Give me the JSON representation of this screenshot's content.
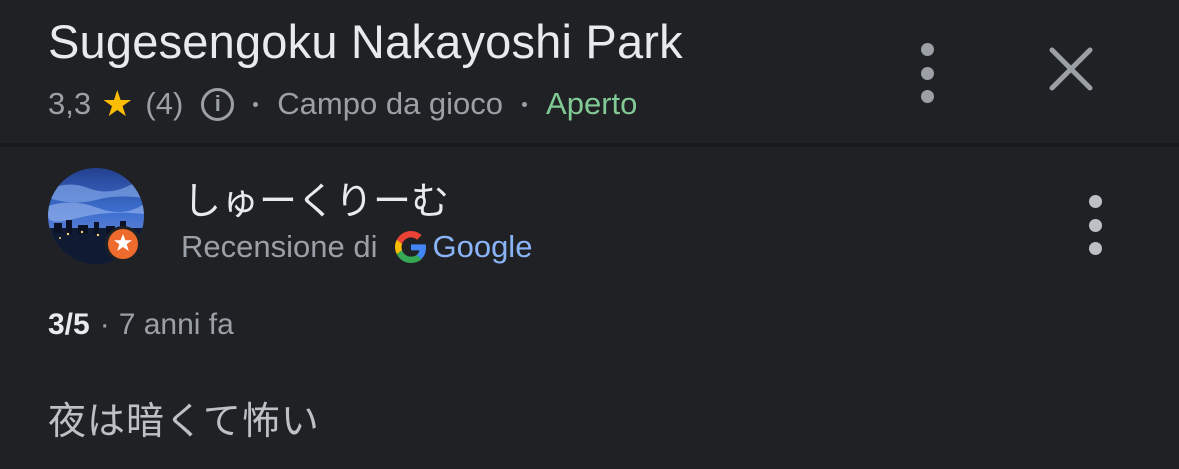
{
  "place": {
    "name": "Sugesengoku Nakayoshi Park",
    "rating": "3,3",
    "review_count": "(4)",
    "category": "Campo da gioco",
    "status": "Aperto",
    "star_icon": "star-icon",
    "star_color": "#fbbc04",
    "status_color": "#81c995"
  },
  "header_actions": {
    "more_icon": "more-vert-icon",
    "close_icon": "close-icon"
  },
  "review": {
    "reviewer_name": "しゅーくりーむ",
    "source_prefix": "Recensione di",
    "source_name": "Google",
    "score": "3/5",
    "separator": "·",
    "time_ago": "7 anni fa",
    "text": "夜は暗くて怖い",
    "link_color": "#8ab4f8",
    "badge_color": "#ee6b2d"
  },
  "colors": {
    "background": "#202124",
    "primary_text": "#e8eaed",
    "secondary_text": "#9aa0a6"
  }
}
